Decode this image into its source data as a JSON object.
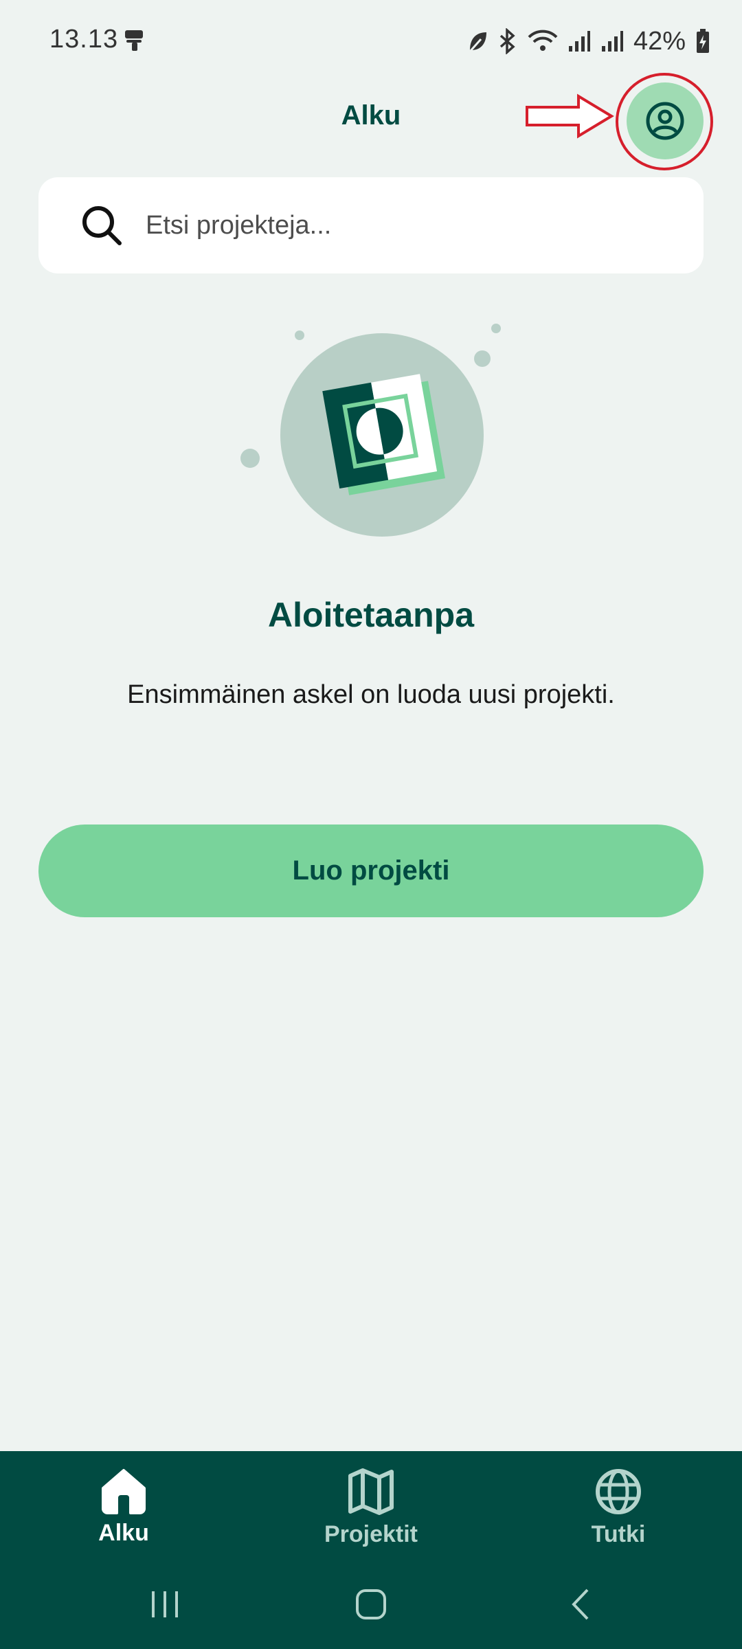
{
  "status_bar": {
    "time": "13.13",
    "battery": "42%"
  },
  "header": {
    "title": "Alku"
  },
  "search": {
    "placeholder": "Etsi projekteja..."
  },
  "empty_state": {
    "heading": "Aloitetaanpa",
    "description": "Ensimmäinen askel on luoda uusi projekti.",
    "button_label": "Luo projekti"
  },
  "bottom_nav": {
    "items": [
      {
        "label": "Alku",
        "icon": "home-icon",
        "active": true
      },
      {
        "label": "Projektit",
        "icon": "map-icon",
        "active": false
      },
      {
        "label": "Tutki",
        "icon": "globe-icon",
        "active": false
      }
    ]
  },
  "colors": {
    "background": "#eef3f1",
    "primary_dark": "#014b42",
    "accent_green": "#79d39b",
    "profile_bg": "#9fdbb3",
    "annotation_red": "#d61f2c"
  }
}
